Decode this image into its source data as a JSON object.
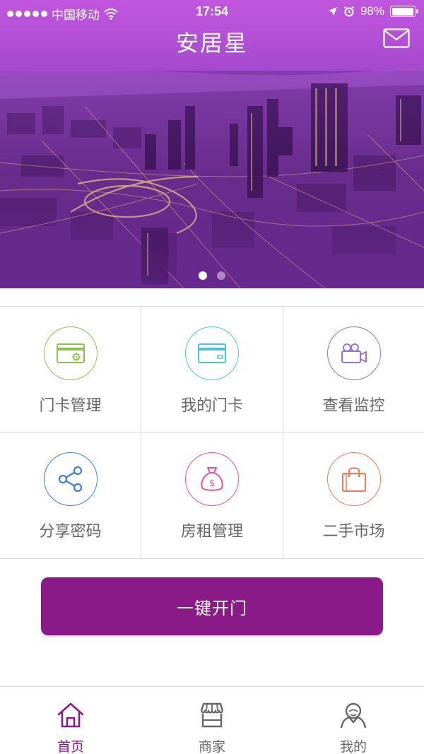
{
  "status_bar": {
    "carrier": "中国移动",
    "time": "17:54",
    "battery": "98%",
    "battery_level": 0.98,
    "icons": [
      "signal-dots",
      "wifi-icon",
      "location-arrow-icon",
      "alarm-icon",
      "battery-icon"
    ]
  },
  "header": {
    "title": "安居星",
    "mail_icon": "mail-icon"
  },
  "banner": {
    "page_count": 2,
    "active_page": 0
  },
  "grid": {
    "items": [
      {
        "label": "门卡管理",
        "icon": "card-gear-icon",
        "color": "#8bc34a"
      },
      {
        "label": "我的门卡",
        "icon": "card-icon",
        "color": "#4fc3d9"
      },
      {
        "label": "查看监控",
        "icon": "video-camera-icon",
        "color": "#9c6fd6"
      },
      {
        "label": "分享密码",
        "icon": "share-icon",
        "color": "#3d7fd6"
      },
      {
        "label": "房租管理",
        "icon": "money-bag-icon",
        "color": "#e84fa8"
      },
      {
        "label": "二手市场",
        "icon": "shopping-bag-icon",
        "color": "#ef7a5a"
      }
    ]
  },
  "primary_action": {
    "label": "一键开门",
    "color": "#8a1a87"
  },
  "tabbar": {
    "tabs": [
      {
        "label": "首页",
        "icon": "home-icon",
        "active": true
      },
      {
        "label": "商家",
        "icon": "store-icon",
        "active": false
      },
      {
        "label": "我的",
        "icon": "user-icon",
        "active": false
      }
    ],
    "active_color": "#8a1a87",
    "inactive_color": "#666666"
  }
}
